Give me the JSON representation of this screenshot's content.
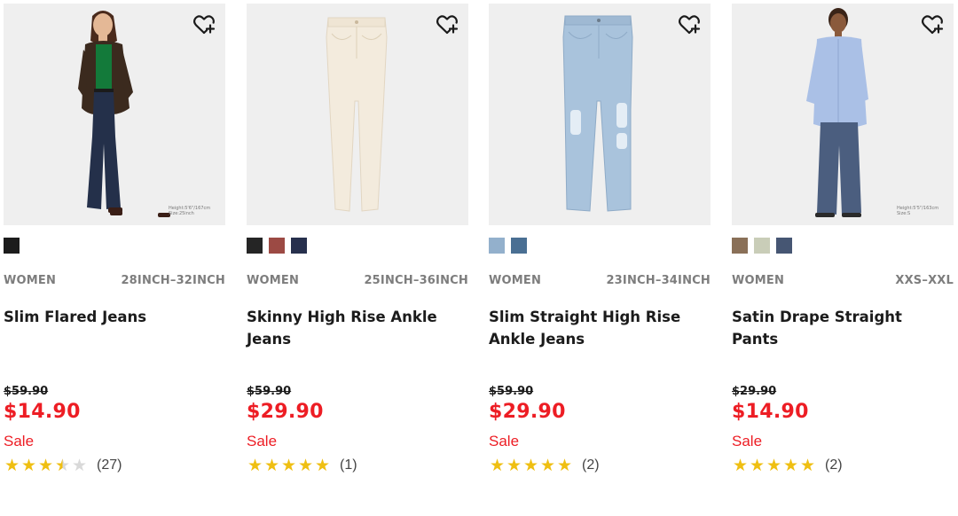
{
  "products": [
    {
      "gender": "WOMEN",
      "size_range": "28INCH–32INCH",
      "name": "Slim Flared Jeans",
      "original_price": "$59.90",
      "sale_price": "$14.90",
      "flag": "Sale",
      "rating": 3.5,
      "review_count": "(27)",
      "model_note_1": "Height:5'6\"/167cm",
      "model_note_2": "Size:25inch",
      "swatches": [
        "#1c1c1c"
      ],
      "favorite_icon": "heart-plus-icon"
    },
    {
      "gender": "WOMEN",
      "size_range": "25INCH–36INCH",
      "name": "Skinny High Rise Ankle Jeans",
      "original_price": "$59.90",
      "sale_price": "$29.90",
      "flag": "Sale",
      "rating": 5,
      "review_count": "(1)",
      "swatches": [
        "#252525",
        "#9c4a44",
        "#27304d"
      ],
      "favorite_icon": "heart-plus-icon"
    },
    {
      "gender": "WOMEN",
      "size_range": "23INCH–34INCH",
      "name": "Slim Straight High Rise Ankle Jeans",
      "original_price": "$59.90",
      "sale_price": "$29.90",
      "flag": "Sale",
      "rating": 5,
      "review_count": "(2)",
      "swatches": [
        "#93b0cc",
        "#4a6f93"
      ],
      "favorite_icon": "heart-plus-icon"
    },
    {
      "gender": "WOMEN",
      "size_range": "XXS–XXL",
      "name": "Satin Drape Straight Pants",
      "original_price": "$29.90",
      "sale_price": "$14.90",
      "flag": "Sale",
      "rating": 5,
      "review_count": "(2)",
      "model_note_1": "Height:5'5\"/163cm",
      "model_note_2": "Size:S",
      "swatches": [
        "#8a7058",
        "#c9cdb8",
        "#465673"
      ],
      "favorite_icon": "heart-plus-icon"
    }
  ],
  "colors": {
    "sale_red": "#ed1d24",
    "star_gold": "#efbf12",
    "image_bg": "#efefef",
    "meta_gray": "#7d7d7d"
  }
}
